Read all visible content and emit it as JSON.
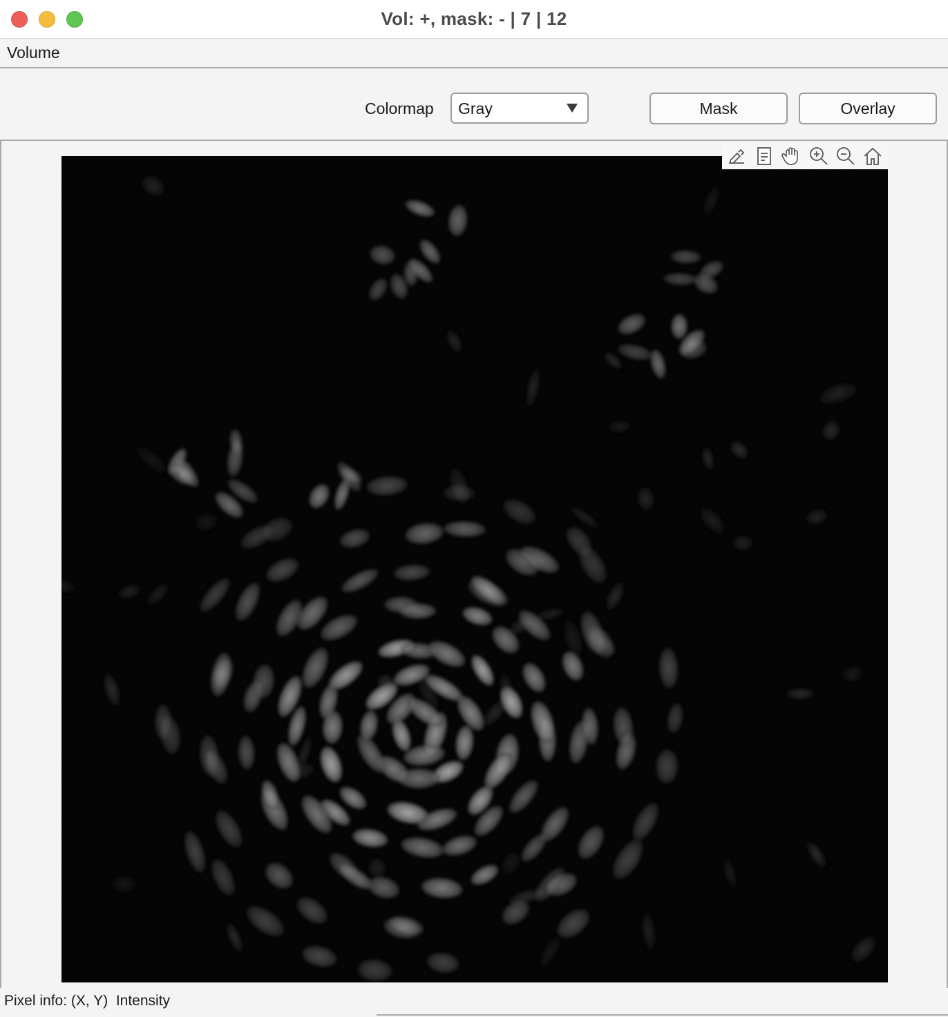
{
  "window": {
    "title": "Vol: +, mask: - | 7 | 12"
  },
  "menubar": {
    "items": [
      {
        "label": "Volume"
      }
    ]
  },
  "controls": {
    "colormap_label": "Colormap",
    "colormap_value": "Gray",
    "mask_label": "Mask",
    "overlay_label": "Overlay"
  },
  "axes_toolbar": {
    "icons": [
      "brush-icon",
      "datatip-icon",
      "pan-icon",
      "zoom-in-icon",
      "zoom-out-icon",
      "home-icon"
    ]
  },
  "status": {
    "text": "Pixel info: (X, Y)  Intensity"
  },
  "colors": {
    "image_background": "#030303",
    "nuclei": "#9a9a9a",
    "window_background": "#f4f4f4"
  }
}
